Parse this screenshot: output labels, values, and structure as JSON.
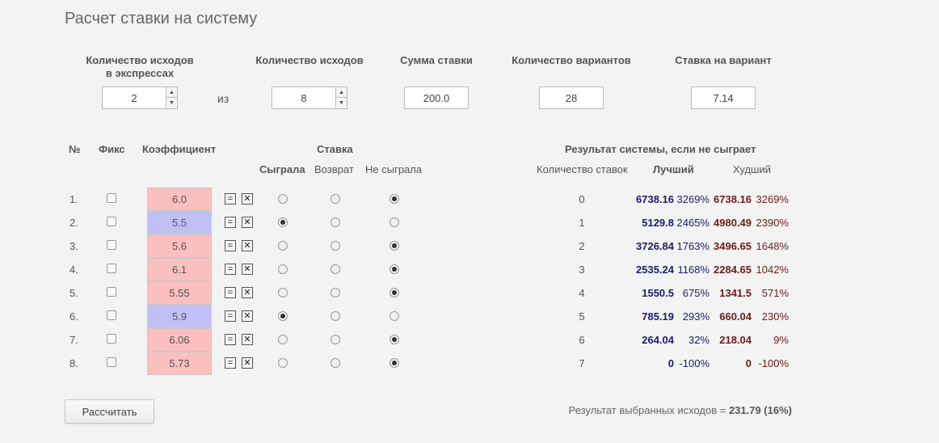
{
  "title": "Расчет ставки на систему",
  "inputs": {
    "outcomes_in_express_label_1": "Количество исходов",
    "outcomes_in_express_label_2": "в экспрессах",
    "outcomes_in_express_value": "2",
    "iz": "из",
    "outcomes_total_label": "Количество исходов",
    "outcomes_total_value": "8",
    "stake_sum_label": "Сумма ставки",
    "stake_sum_value": "200.0",
    "variants_label": "Количество вариантов",
    "variants_value": "28",
    "stake_per_variant_label": "Ставка на вариант",
    "stake_per_variant_value": "7.14",
    "spin_up": "▲",
    "spin_down": "▼"
  },
  "table_headers": {
    "num": "№",
    "fix": "Фикс",
    "coef": "Коэффициент",
    "stake": "Ставка",
    "won": "Сыграла",
    "refund": "Возврат",
    "lost": "Не сыграла",
    "system_result": "Результат системы, если не сыграет",
    "bet_count": "Количество ставок",
    "best": "Лучший",
    "worst": "Худший"
  },
  "buttons": {
    "eq": "=",
    "x": "✕",
    "calculate": "Рассчитать"
  },
  "rows": [
    {
      "num": "1.",
      "coef": "6.0",
      "color": "pink",
      "state": "lost"
    },
    {
      "num": "2.",
      "coef": "5.5",
      "color": "blue",
      "state": "won"
    },
    {
      "num": "3.",
      "coef": "5.6",
      "color": "pink",
      "state": "lost"
    },
    {
      "num": "4.",
      "coef": "6.1",
      "color": "pink",
      "state": "lost"
    },
    {
      "num": "5.",
      "coef": "5.55",
      "color": "pink",
      "state": "lost"
    },
    {
      "num": "6.",
      "coef": "5.9",
      "color": "blue",
      "state": "won"
    },
    {
      "num": "7.",
      "coef": "6.06",
      "color": "pink",
      "state": "lost"
    },
    {
      "num": "8.",
      "coef": "5.73",
      "color": "pink",
      "state": "lost"
    }
  ],
  "results": [
    {
      "count": "0",
      "best": "6738.16",
      "best_pct": "3269%",
      "worst": "6738.16",
      "worst_pct": "3269%"
    },
    {
      "count": "1",
      "best": "5129.8",
      "best_pct": "2465%",
      "worst": "4980.49",
      "worst_pct": "2390%"
    },
    {
      "count": "2",
      "best": "3726.84",
      "best_pct": "1763%",
      "worst": "3496.65",
      "worst_pct": "1648%"
    },
    {
      "count": "3",
      "best": "2535.24",
      "best_pct": "1168%",
      "worst": "2284.65",
      "worst_pct": "1042%"
    },
    {
      "count": "4",
      "best": "1550.5",
      "best_pct": "675%",
      "worst": "1341.5",
      "worst_pct": "571%"
    },
    {
      "count": "5",
      "best": "785.19",
      "best_pct": "293%",
      "worst": "660.04",
      "worst_pct": "230%"
    },
    {
      "count": "6",
      "best": "264.04",
      "best_pct": "32%",
      "worst": "218.04",
      "worst_pct": "9%"
    },
    {
      "count": "7",
      "best": "0",
      "best_pct": "-100%",
      "worst": "0",
      "worst_pct": "-100%"
    }
  ],
  "summary": {
    "text": "Результат выбранных исходов = ",
    "value": "231.79 (16%)"
  },
  "colors": {
    "pink_cell": "#fcbfc0",
    "blue_cell": "#c0c0f7",
    "best": "#1c1c6e",
    "worst": "#6e1c1c"
  }
}
